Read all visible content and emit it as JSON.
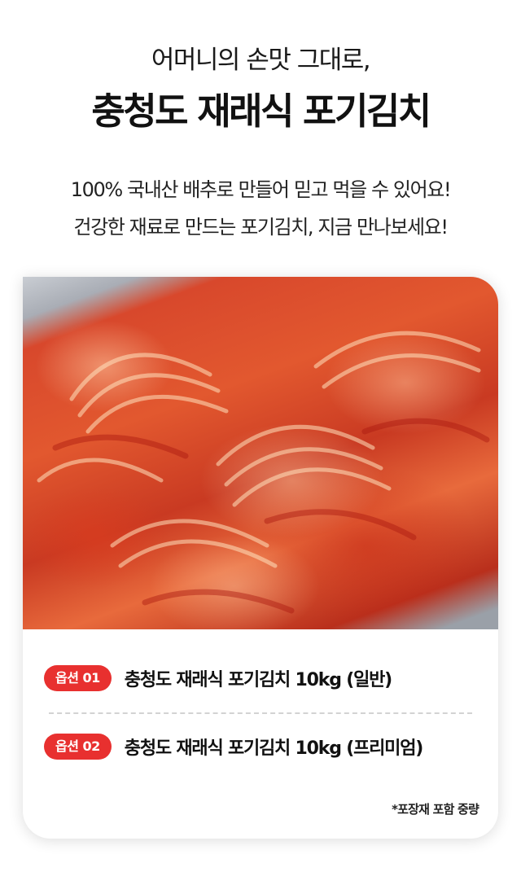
{
  "header": {
    "subtitle": "어머니의 손맛 그대로,",
    "title": "충청도 재래식 포기김치"
  },
  "description": {
    "line1": "100% 국내산 배추로 만들어 믿고 먹을 수 있어요!",
    "line2": "건강한 재료로 만드는 포기김치, 지금 만나보세요!"
  },
  "options": [
    {
      "badge": "옵션 01",
      "label": "충청도 재래식 포기김치 10kg (일반)"
    },
    {
      "badge": "옵션 02",
      "label": "충청도 재래식 포기김치 10kg (프리미엄)"
    }
  ],
  "note": "*포장재 포함 중량",
  "colors": {
    "badge": "#e8302f",
    "kimchi": "#d8482c"
  }
}
